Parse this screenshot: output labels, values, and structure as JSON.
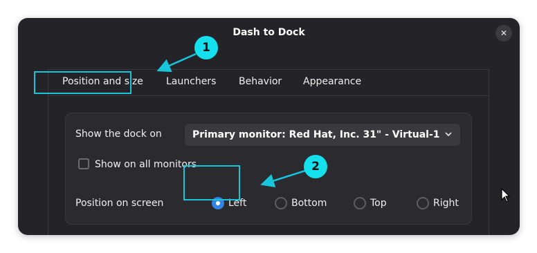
{
  "window": {
    "title": "Dash to Dock",
    "close_icon": "close-icon"
  },
  "tabs": [
    {
      "label": "Position and size",
      "active": true
    },
    {
      "label": "Launchers",
      "active": false
    },
    {
      "label": "Behavior",
      "active": false
    },
    {
      "label": "Appearance",
      "active": false
    }
  ],
  "settings": {
    "show_dock_label": "Show the dock on",
    "monitor_value": "Primary monitor: Red Hat, Inc. 31\" - Virtual-1",
    "all_monitors_label": "Show on all monitors",
    "all_monitors_checked": false,
    "position_label": "Position on screen",
    "positions": [
      {
        "label": "Left",
        "selected": true
      },
      {
        "label": "Bottom",
        "selected": false
      },
      {
        "label": "Top",
        "selected": false
      },
      {
        "label": "Right",
        "selected": false
      }
    ]
  },
  "annotations": {
    "badge_1": "1",
    "badge_2": "2"
  },
  "colors": {
    "accent": "#3584e4",
    "highlight": "#18c5dc",
    "window_bg": "#242428"
  }
}
